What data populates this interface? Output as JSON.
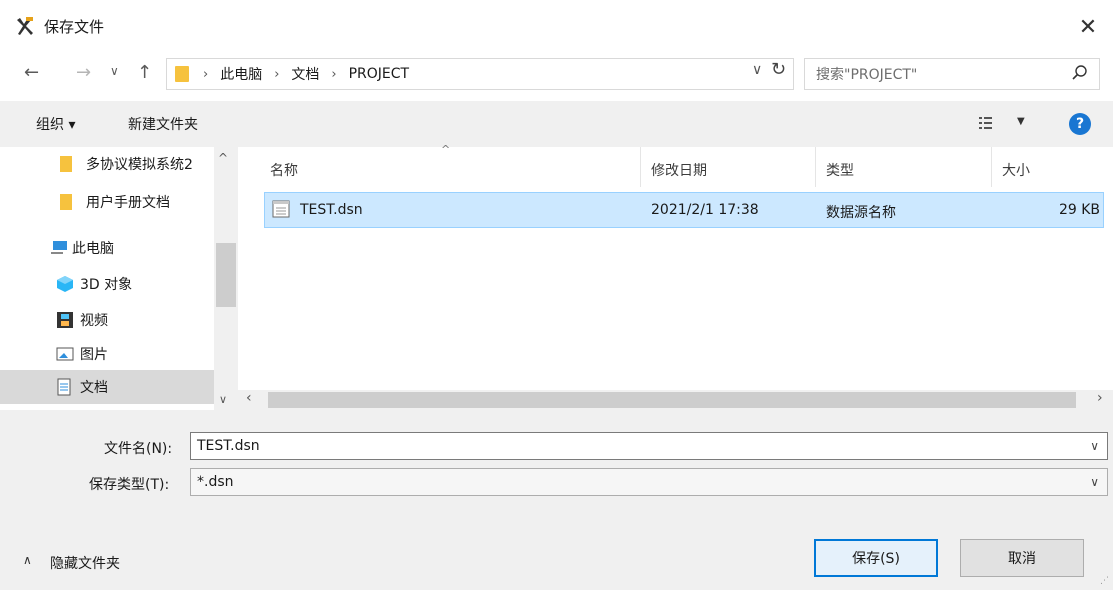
{
  "window": {
    "title": "保存文件"
  },
  "address": {
    "breadcrumbs": [
      "此电脑",
      "文档",
      "PROJECT"
    ]
  },
  "search": {
    "placeholder": "搜索\"PROJECT\""
  },
  "toolbar": {
    "organize_label": "组织 ▾",
    "new_folder_label": "新建文件夹"
  },
  "nav": {
    "items": [
      {
        "label": "多协议模拟系统2",
        "icon": "folder-icon"
      },
      {
        "label": "用户手册文档",
        "icon": "folder-icon"
      },
      {
        "label": "此电脑",
        "icon": "computer-icon"
      },
      {
        "label": "3D 对象",
        "icon": "3d-objects-icon"
      },
      {
        "label": "视频",
        "icon": "video-icon"
      },
      {
        "label": "图片",
        "icon": "picture-icon"
      },
      {
        "label": "文档",
        "icon": "document-icon"
      }
    ]
  },
  "columns": {
    "name": "名称",
    "modified": "修改日期",
    "type": "类型",
    "size": "大小"
  },
  "files": [
    {
      "name": "TEST.dsn",
      "modified": "2021/2/1 17:38",
      "type": "数据源名称",
      "size": "29 KB"
    }
  ],
  "form": {
    "filename_label": "文件名(N):",
    "filename_value": "TEST.dsn",
    "filetype_label": "保存类型(T):",
    "filetype_value": "*.dsn"
  },
  "footer": {
    "hide_folders_label": "隐藏文件夹",
    "save_label": "保存(S)",
    "cancel_label": "取消"
  }
}
